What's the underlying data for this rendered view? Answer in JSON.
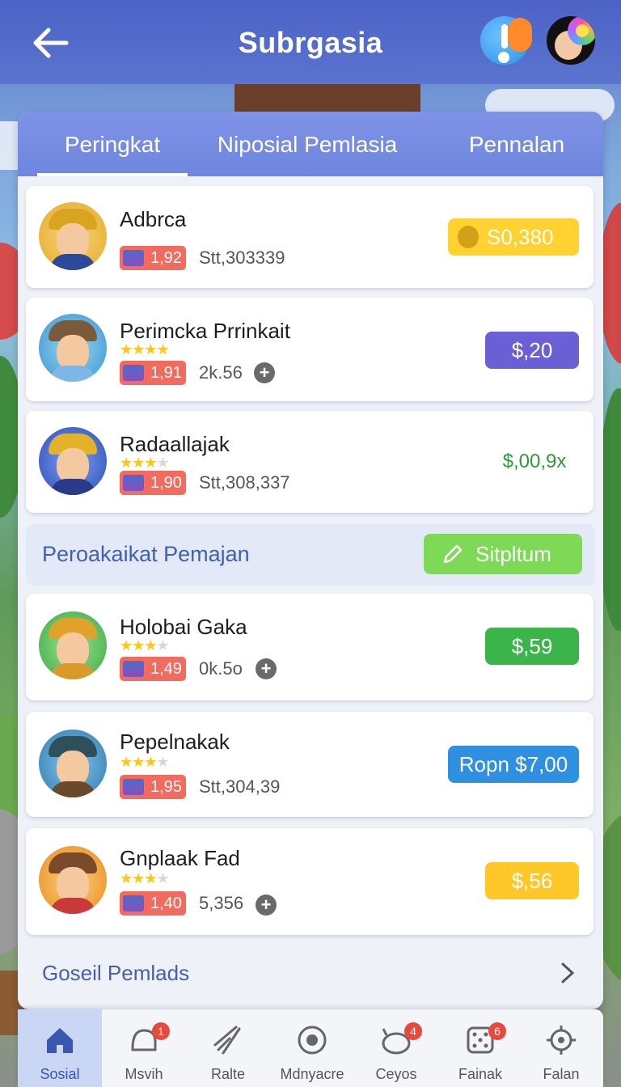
{
  "header": {
    "title": "Subrgasia",
    "back_icon": "back-arrow-icon",
    "info_icon": "info-icon",
    "profile_icon": "profile-avatar-icon"
  },
  "tabs": [
    {
      "label": "Peringkat",
      "active": true
    },
    {
      "label": "Niposial Pemlasia",
      "active": false
    },
    {
      "label": "Pennalan",
      "active": false
    }
  ],
  "players": [
    {
      "name": "Adbrca",
      "rank": "1,92",
      "score": "Stt,303339",
      "price": "S0,380",
      "stars": 0,
      "plus": false,
      "price_color": "#ffd232",
      "price_text_color": "#fff",
      "coin_icon": true
    },
    {
      "name": "Perimcka Prrinkait",
      "rank": "1,91",
      "score": "2k.56",
      "price": "$,20",
      "stars": 4,
      "plus": true,
      "price_color": "#6b5fd6",
      "price_text_color": "#fff"
    },
    {
      "name": "Radaallajak",
      "rank": "1,90",
      "score": "Stt,308,337",
      "price": "$,00,9x",
      "stars": 3,
      "plus": false,
      "price_color": "transparent",
      "price_text_color": "#2e9a3a"
    }
  ],
  "section": {
    "title": "Peroakaikat Pemajan",
    "action_label": "Sitpltum",
    "action_icon": "pencil-icon"
  },
  "players2": [
    {
      "name": "Holobai Gaka",
      "rank": "1,49",
      "score": "0k.5o",
      "price": "$,59",
      "stars": 3,
      "plus": true,
      "price_color": "#3bb54a",
      "price_text_color": "#fff"
    },
    {
      "name": "Pepelnakak",
      "rank": "1,95",
      "score": "Stt,304,39",
      "price": "Ropn $7,00",
      "stars": 3,
      "plus": false,
      "price_color": "#2f8fe0",
      "price_text_color": "#fff"
    },
    {
      "name": "Gnplaak Fad",
      "rank": "1,40",
      "score": "5,356",
      "price": "$,56",
      "stars": 3,
      "plus": true,
      "price_color": "#ffc828",
      "price_text_color": "#fff"
    }
  ],
  "footer_link": "Goseil Pemlads",
  "nav": [
    {
      "label": "Sosial",
      "icon": "home-icon",
      "active": true,
      "badge": ""
    },
    {
      "label": "Msvih",
      "icon": "chat-icon",
      "active": false,
      "badge": "1"
    },
    {
      "label": "Ralte",
      "icon": "rocket-icon",
      "active": false,
      "badge": ""
    },
    {
      "label": "Mdnyacre",
      "icon": "target-icon",
      "active": false,
      "badge": ""
    },
    {
      "label": "Ceyos",
      "icon": "monster-icon",
      "active": false,
      "badge": "4"
    },
    {
      "label": "Fainak",
      "icon": "dice-icon",
      "active": false,
      "badge": "6"
    },
    {
      "label": "Falan",
      "icon": "gear-icon",
      "active": false,
      "badge": ""
    }
  ]
}
